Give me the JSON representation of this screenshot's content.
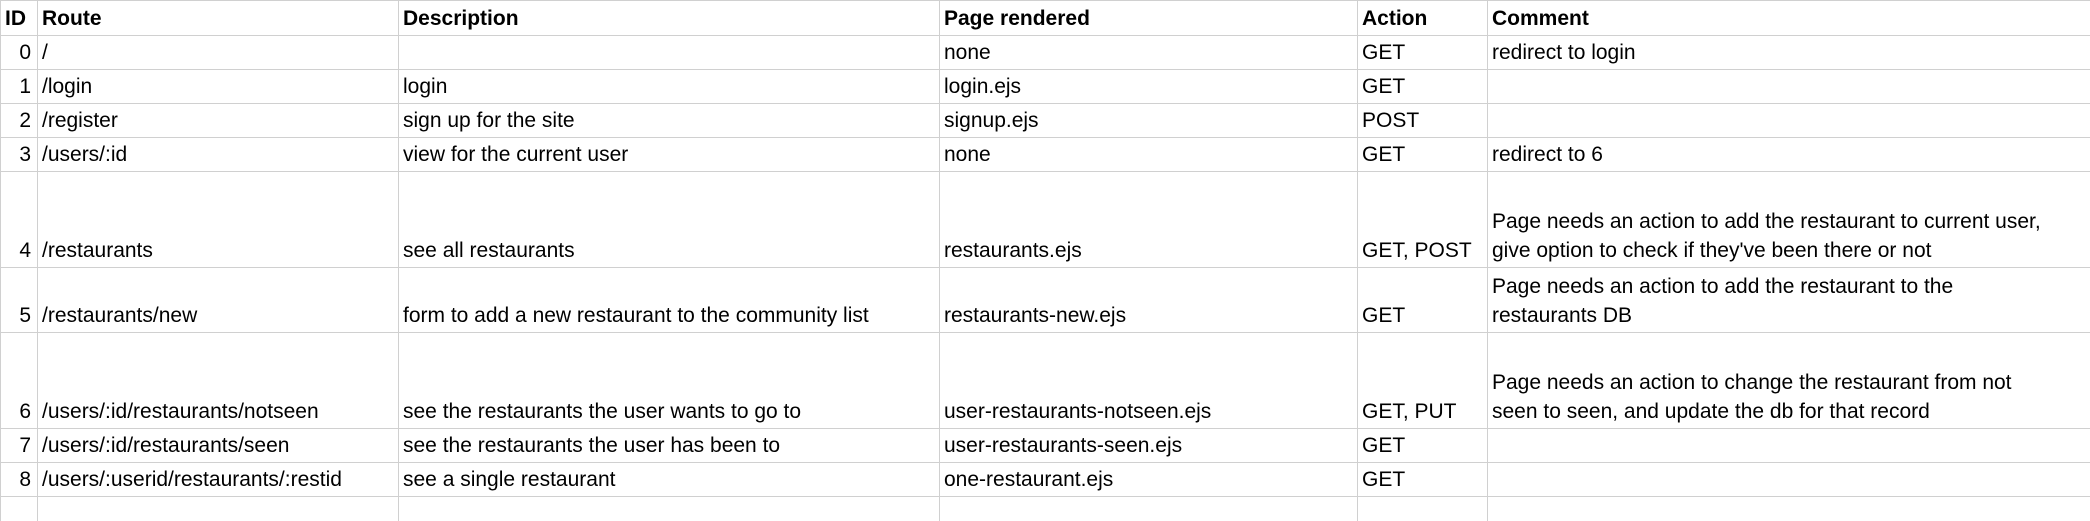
{
  "columns": [
    "ID",
    "Route",
    "Description",
    "Page rendered",
    "Action",
    "Comment"
  ],
  "rows": [
    {
      "id": "0",
      "route": "/",
      "description": "",
      "page": "none",
      "action": "GET",
      "comment": [
        "redirect to login"
      ]
    },
    {
      "id": "1",
      "route": "/login",
      "description": "login",
      "page": "login.ejs",
      "action": "GET",
      "comment": []
    },
    {
      "id": "2",
      "route": "/register",
      "description": "sign up for the site",
      "page": "signup.ejs",
      "action": "POST",
      "comment": []
    },
    {
      "id": "3",
      "route": "/users/:id",
      "description": "view for the current user",
      "page": "none",
      "action": "GET",
      "comment": [
        "redirect to 6"
      ]
    },
    {
      "id": "4",
      "route": "/restaurants",
      "description": "see all restaurants",
      "page": "restaurants.ejs",
      "action": "GET, POST",
      "comment": [
        "Page needs an action to add the restaurant to current user,",
        "give option to check if they've been there or not"
      ]
    },
    {
      "id": "5",
      "route": "/restaurants/new",
      "description": "form to add a new restaurant to the community list",
      "page": "restaurants-new.ejs",
      "action": "GET",
      "comment": [
        "Page needs an action to add the restaurant to the",
        "restaurants DB"
      ]
    },
    {
      "id": "6",
      "route": "/users/:id/restaurants/notseen",
      "description": "see the restaurants the user wants to go to",
      "page": "user-restaurants-notseen.ejs",
      "action": "GET, PUT",
      "comment": [
        "Page needs an action to change the restaurant from not",
        "seen to seen, and update the db for that record"
      ]
    },
    {
      "id": "7",
      "route": "/users/:id/restaurants/seen",
      "description": "see the restaurants the user has been to",
      "page": "user-restaurants-seen.ejs",
      "action": "GET",
      "comment": []
    },
    {
      "id": "8",
      "route": "/users/:userid/restaurants/:restid",
      "description": "see a single restaurant",
      "page": "one-restaurant.ejs",
      "action": "GET",
      "comment": []
    }
  ]
}
